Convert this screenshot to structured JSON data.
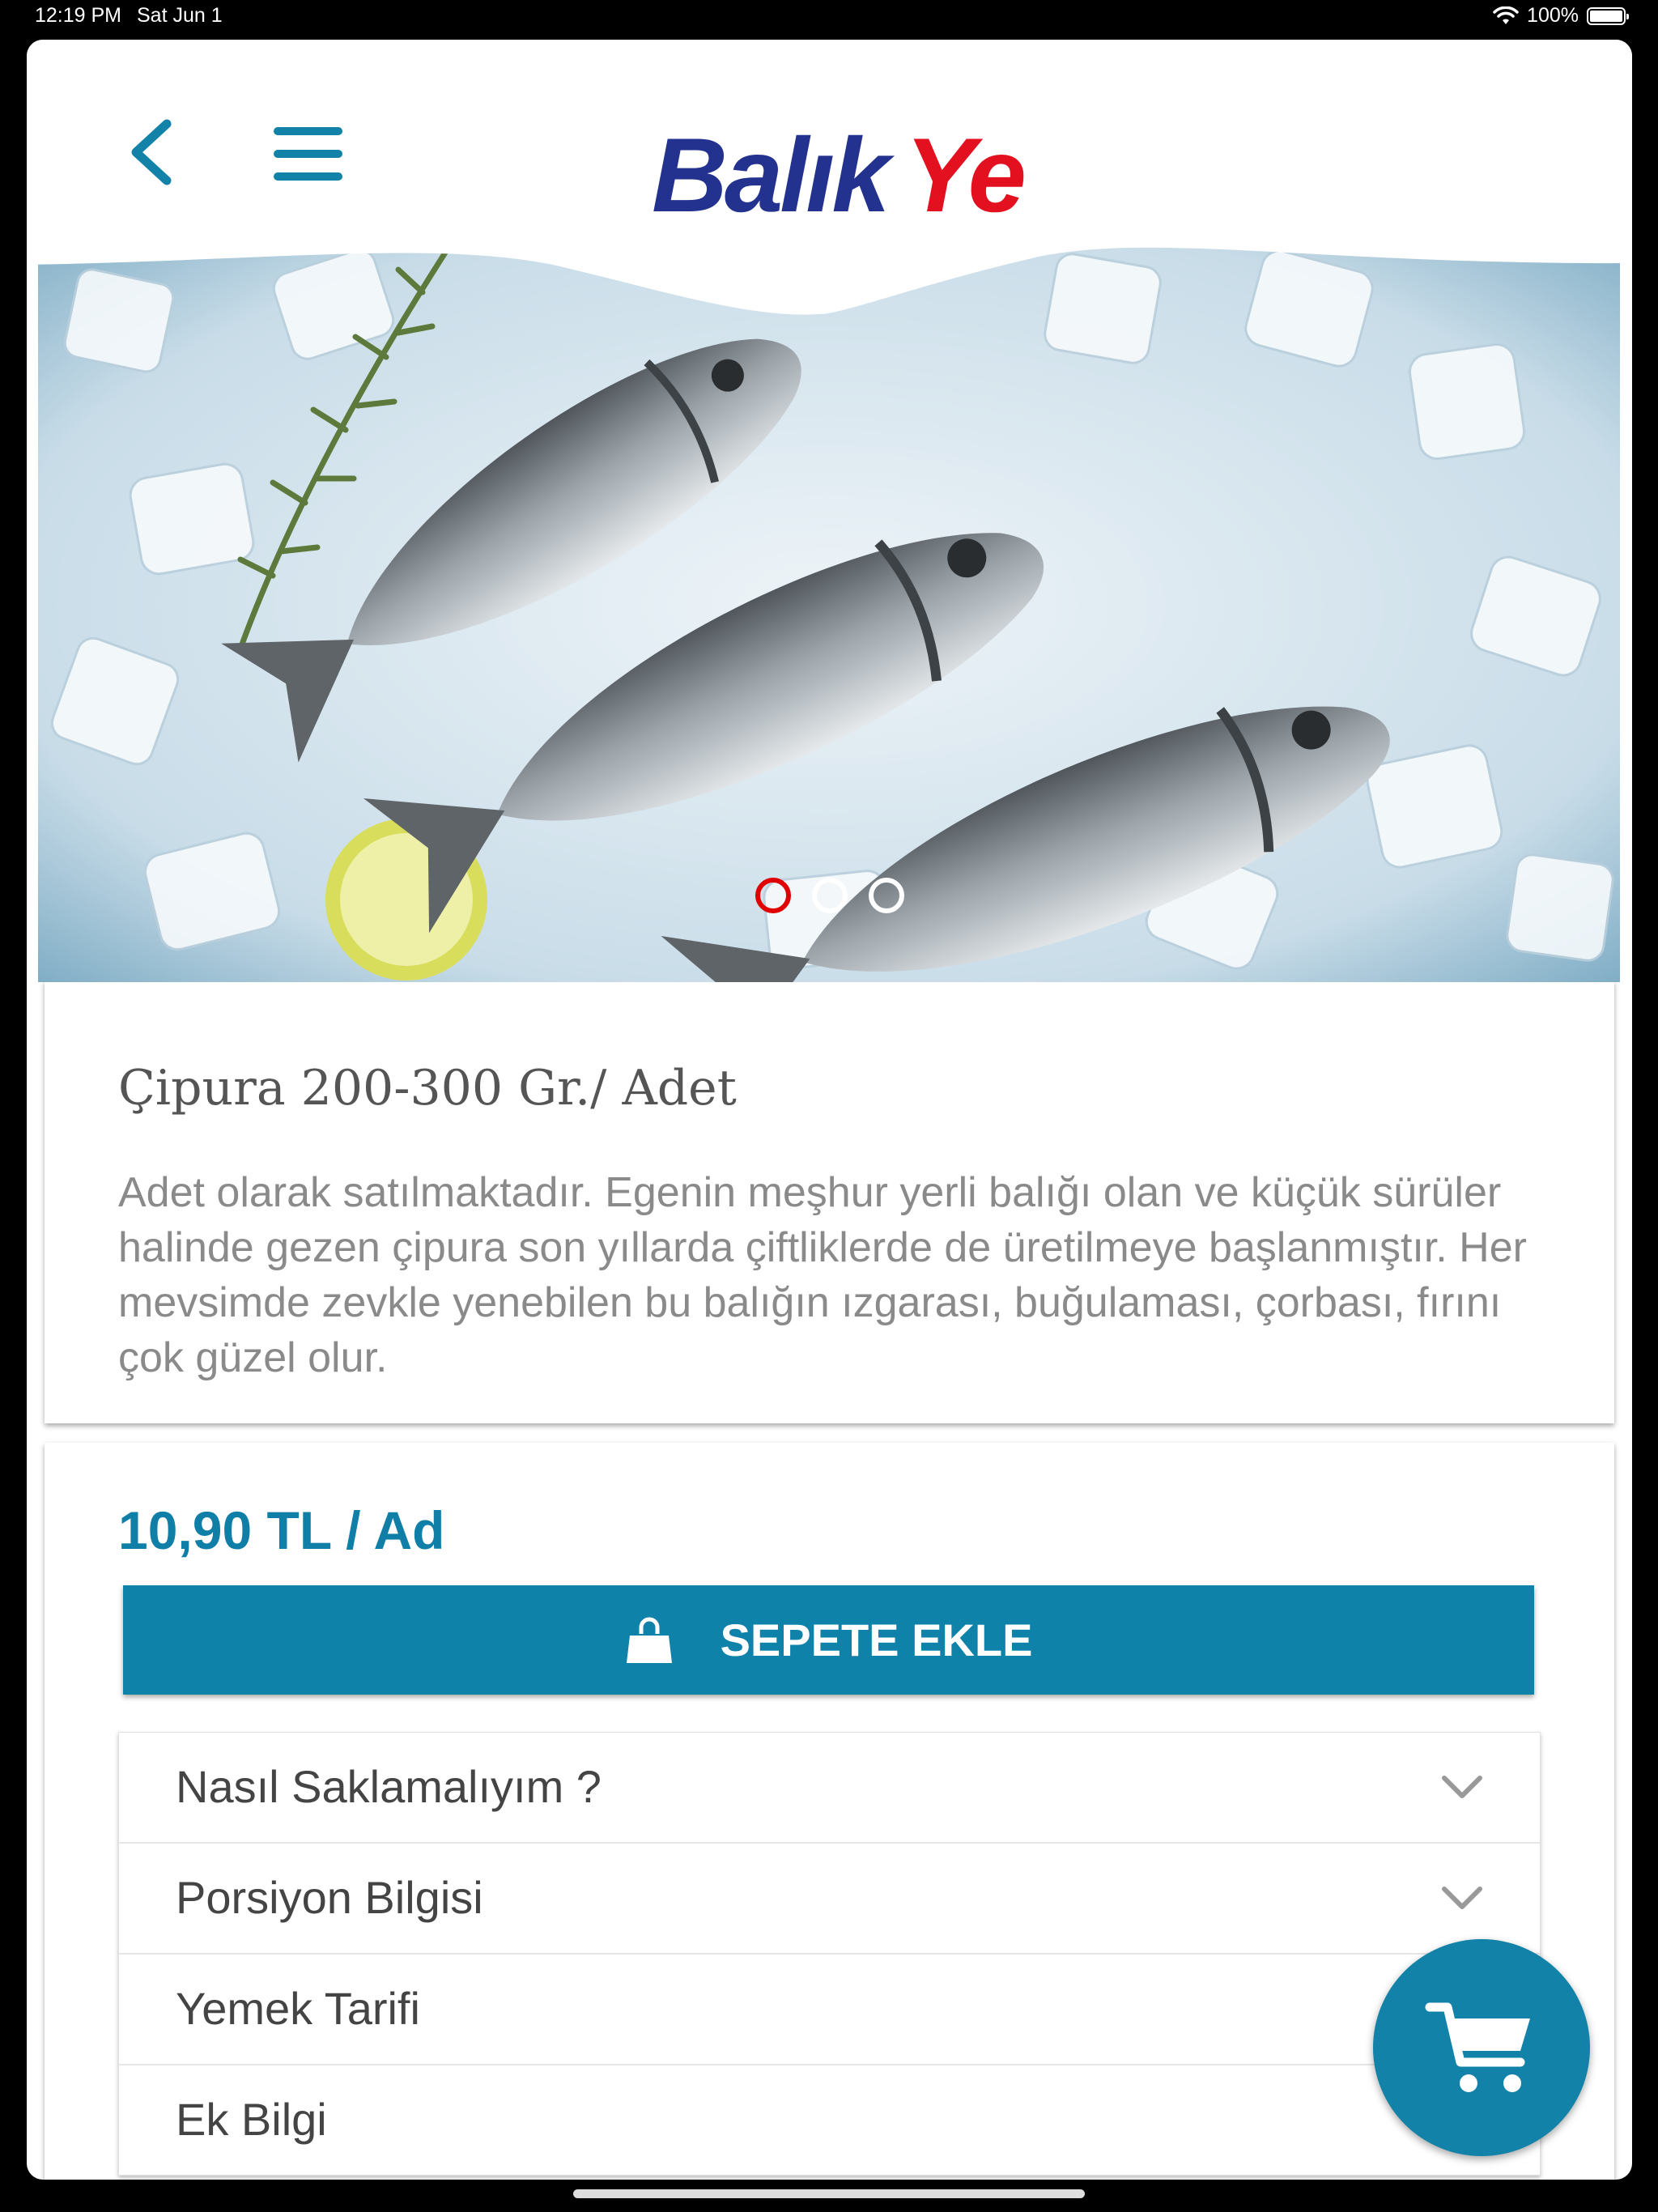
{
  "status_bar": {
    "time": "12:19 PM",
    "date": "Sat Jun 1",
    "battery": "100%"
  },
  "header": {
    "logo_part1": "Balık",
    "logo_part2": "Ye",
    "brand_blue": "#24328f",
    "brand_red": "#e3101f"
  },
  "carousel": {
    "image": "fresh-sea-bream-on-ice-photo",
    "active_index": 0,
    "count": 3
  },
  "product": {
    "title": "Çipura 200-300 Gr./ Adet",
    "description": "Adet olarak satılmaktadır. Egenin meşhur yerli balığı olan ve küçük sürüler halinde gezen çipura son yıllarda çiftliklerde de üretilmeye başlanmıştır. Her mevsimde zevkle yenebilen bu balığın ızgarası, buğulaması, çorbası, fırını çok güzel olur.",
    "price": "10,90 TL / Ad",
    "add_to_cart": "SEPETE EKLE"
  },
  "accordion": [
    {
      "label": "Nasıl Saklamalıyım ?",
      "icon": "chevron-down-icon"
    },
    {
      "label": "Porsiyon Bilgisi",
      "icon": "chevron-down-icon"
    },
    {
      "label": "Yemek Tarifi",
      "icon": "chevron-down-icon"
    },
    {
      "label": "Ek Bilgi",
      "icon": "chevron-down-icon"
    }
  ],
  "colors": {
    "accent": "#0f82aa",
    "price": "#0f7fa7",
    "active_dot": "#e00000"
  }
}
